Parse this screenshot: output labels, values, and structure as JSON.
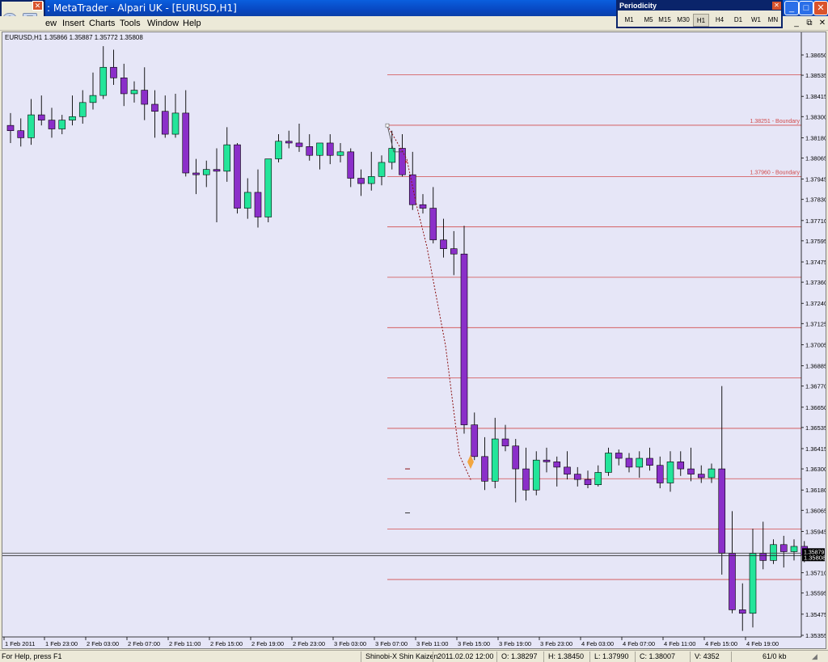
{
  "window": {
    "title": ": MetaTrader - Alpari UK - [EURUSD,H1]"
  },
  "menu": [
    "ew",
    "Insert",
    "Charts",
    "Tools",
    "Window",
    "Help"
  ],
  "periodicity": {
    "title": "Periodicity",
    "buttons": [
      "M1",
      "M5",
      "M15",
      "M30",
      "H1",
      "H4",
      "D1",
      "W1",
      "MN"
    ],
    "active": "H1"
  },
  "chart": {
    "header": "EURUSD,H1  1.35866 1.35887 1.35772 1.35808",
    "colors": {
      "bg": "#e6e6f7",
      "bull": "#23e59a",
      "bear": "#8b2fc9",
      "level": "#d24b4b",
      "label": "#d24b4b"
    },
    "boundary_labels": [
      {
        "price": 1.38251,
        "text": "1.38251 - Boundary"
      },
      {
        "price": 1.3796,
        "text": "1.37960 - Boundary"
      }
    ],
    "current_price_label": "1.35808",
    "overlap_price_label": "1.35879"
  },
  "chart_data": {
    "type": "candlestick",
    "symbol": "EURUSD",
    "timeframe": "H1",
    "ylim": [
      1.353,
      1.3672
    ],
    "y_ticks": [
      "1.36650",
      "1.36535",
      "1.36415",
      "1.36300",
      "1.36180",
      "1.36065",
      "1.35945",
      "1.35710",
      "1.35595",
      "1.35475",
      "1.35355",
      "1.38415",
      "1.38300",
      "1.38180",
      "1.38065",
      "1.37945",
      "1.37830",
      "1.37710",
      "1.37595",
      "1.37475",
      "1.37360",
      "1.37240",
      "1.37125",
      "1.37005",
      "1.36885",
      "1.36770",
      "1.38535",
      "1.38650"
    ],
    "y_tick_values": [
      1.3665,
      1.36535,
      1.36415,
      1.363,
      1.3618,
      1.36065,
      1.35945,
      1.3571,
      1.35595,
      1.35475,
      1.35355,
      1.38415,
      1.383,
      1.3818,
      1.38065,
      1.37945,
      1.3783,
      1.3771,
      1.37595,
      1.37475,
      1.3736,
      1.3724,
      1.37125,
      1.37005,
      1.36885,
      1.3677,
      1.38535,
      1.3865
    ],
    "x_labels": [
      "1 Feb 2011",
      "1 Feb 23:00",
      "2 Feb 03:00",
      "2 Feb 07:00",
      "2 Feb 11:00",
      "2 Feb 15:00",
      "2 Feb 19:00",
      "2 Feb 23:00",
      "3 Feb 03:00",
      "3 Feb 07:00",
      "3 Feb 11:00",
      "3 Feb 15:00",
      "3 Feb 19:00",
      "3 Feb 23:00",
      "4 Feb 03:00",
      "4 Feb 07:00",
      "4 Feb 11:00",
      "4 Feb 15:00",
      "4 Feb 19:00"
    ],
    "horizontal_levels": [
      1.38537,
      1.38251,
      1.3796,
      1.37674,
      1.37388,
      1.37102,
      1.36816,
      1.3653,
      1.36244,
      1.35958,
      1.35672
    ],
    "current_price": 1.35808,
    "ohlc": [
      [
        1.3825,
        1.3832,
        1.3815,
        1.3822
      ],
      [
        1.3822,
        1.3829,
        1.3813,
        1.3818
      ],
      [
        1.3818,
        1.384,
        1.3814,
        1.3831
      ],
      [
        1.3831,
        1.3842,
        1.3825,
        1.3828
      ],
      [
        1.3828,
        1.3835,
        1.3818,
        1.3823
      ],
      [
        1.3823,
        1.3831,
        1.382,
        1.3828
      ],
      [
        1.3828,
        1.3842,
        1.3825,
        1.383
      ],
      [
        1.383,
        1.3845,
        1.3826,
        1.3838
      ],
      [
        1.3838,
        1.3855,
        1.3834,
        1.3842
      ],
      [
        1.3842,
        1.387,
        1.384,
        1.3858
      ],
      [
        1.3858,
        1.3868,
        1.3848,
        1.3852
      ],
      [
        1.3852,
        1.386,
        1.3836,
        1.3843
      ],
      [
        1.3843,
        1.385,
        1.3838,
        1.3845
      ],
      [
        1.3845,
        1.3858,
        1.3828,
        1.3837
      ],
      [
        1.3837,
        1.3845,
        1.3818,
        1.3833
      ],
      [
        1.3833,
        1.3842,
        1.3818,
        1.382
      ],
      [
        1.382,
        1.3843,
        1.3818,
        1.3832
      ],
      [
        1.3832,
        1.3845,
        1.3796,
        1.3798
      ],
      [
        1.3798,
        1.3806,
        1.3786,
        1.3797
      ],
      [
        1.3797,
        1.3805,
        1.379,
        1.38
      ],
      [
        1.38,
        1.3812,
        1.377,
        1.3799
      ],
      [
        1.3799,
        1.3824,
        1.3793,
        1.3814
      ],
      [
        1.3814,
        1.3815,
        1.3775,
        1.3778
      ],
      [
        1.3778,
        1.3795,
        1.3772,
        1.3787
      ],
      [
        1.3787,
        1.38,
        1.3767,
        1.3773
      ],
      [
        1.3773,
        1.3805,
        1.377,
        1.3806
      ],
      [
        1.3806,
        1.382,
        1.3804,
        1.3816
      ],
      [
        1.3816,
        1.3822,
        1.3812,
        1.3815
      ],
      [
        1.3815,
        1.3826,
        1.381,
        1.3813
      ],
      [
        1.3813,
        1.382,
        1.3805,
        1.3808
      ],
      [
        1.3808,
        1.3815,
        1.38,
        1.3815
      ],
      [
        1.3815,
        1.382,
        1.3803,
        1.3808
      ],
      [
        1.3808,
        1.3815,
        1.3804,
        1.381
      ],
      [
        1.381,
        1.3812,
        1.379,
        1.3795
      ],
      [
        1.3795,
        1.38,
        1.3785,
        1.3792
      ],
      [
        1.3792,
        1.381,
        1.3788,
        1.3796
      ],
      [
        1.3796,
        1.3808,
        1.3791,
        1.3804
      ],
      [
        1.3804,
        1.3822,
        1.38,
        1.3812
      ],
      [
        1.3812,
        1.382,
        1.3796,
        1.3797
      ],
      [
        1.3797,
        1.381,
        1.3777,
        1.378
      ],
      [
        1.378,
        1.3786,
        1.3775,
        1.3778
      ],
      [
        1.3778,
        1.379,
        1.3758,
        1.376
      ],
      [
        1.376,
        1.3772,
        1.375,
        1.3755
      ],
      [
        1.3755,
        1.3765,
        1.374,
        1.3752
      ],
      [
        1.3752,
        1.3768,
        1.365,
        1.3655
      ],
      [
        1.3655,
        1.3662,
        1.3635,
        1.3637
      ],
      [
        1.3637,
        1.3648,
        1.3618,
        1.3623
      ],
      [
        1.3623,
        1.3659,
        1.3619,
        1.3647
      ],
      [
        1.3647,
        1.3655,
        1.364,
        1.3643
      ],
      [
        1.3643,
        1.3647,
        1.3611,
        1.363
      ],
      [
        1.363,
        1.3642,
        1.3612,
        1.3618
      ],
      [
        1.3618,
        1.364,
        1.3615,
        1.3635
      ],
      [
        1.3635,
        1.3642,
        1.3628,
        1.3634
      ],
      [
        1.3634,
        1.3637,
        1.362,
        1.3631
      ],
      [
        1.3631,
        1.364,
        1.3624,
        1.3627
      ],
      [
        1.3627,
        1.3631,
        1.362,
        1.3624
      ],
      [
        1.3624,
        1.3629,
        1.3619,
        1.3621
      ],
      [
        1.3621,
        1.3632,
        1.362,
        1.3628
      ],
      [
        1.3628,
        1.3642,
        1.3626,
        1.3639
      ],
      [
        1.3639,
        1.3641,
        1.3632,
        1.3636
      ],
      [
        1.3636,
        1.3639,
        1.3628,
        1.3631
      ],
      [
        1.3631,
        1.364,
        1.3625,
        1.3636
      ],
      [
        1.3636,
        1.3642,
        1.3629,
        1.3632
      ],
      [
        1.3632,
        1.3637,
        1.3619,
        1.3622
      ],
      [
        1.3622,
        1.364,
        1.3617,
        1.3634
      ],
      [
        1.3634,
        1.364,
        1.3626,
        1.363
      ],
      [
        1.363,
        1.3642,
        1.3623,
        1.3627
      ],
      [
        1.3627,
        1.3632,
        1.3622,
        1.3625
      ],
      [
        1.3625,
        1.3633,
        1.3622,
        1.363
      ],
      [
        1.363,
        1.3677,
        1.357,
        1.3582
      ],
      [
        1.3582,
        1.3606,
        1.3548,
        1.355
      ],
      [
        1.355,
        1.3565,
        1.3538,
        1.3548
      ],
      [
        1.3548,
        1.3596,
        1.354,
        1.3582
      ],
      [
        1.3582,
        1.36,
        1.3573,
        1.3578
      ],
      [
        1.3578,
        1.359,
        1.3576,
        1.3587
      ],
      [
        1.3587,
        1.3592,
        1.3574,
        1.3583
      ],
      [
        1.3583,
        1.359,
        1.3578,
        1.3586
      ],
      [
        1.3586,
        1.3589,
        1.3577,
        1.3581
      ]
    ]
  },
  "status": {
    "help": "For Help, press F1",
    "profile": "Shinobi-X Shin Kaizen",
    "datetime": "2011.02.02 12:00",
    "open": "O: 1.38297",
    "high": "H: 1.38450",
    "low": "L: 1.37990",
    "close": "C: 1.38007",
    "volume": "V: 4352",
    "traffic": "61/0 kb"
  }
}
